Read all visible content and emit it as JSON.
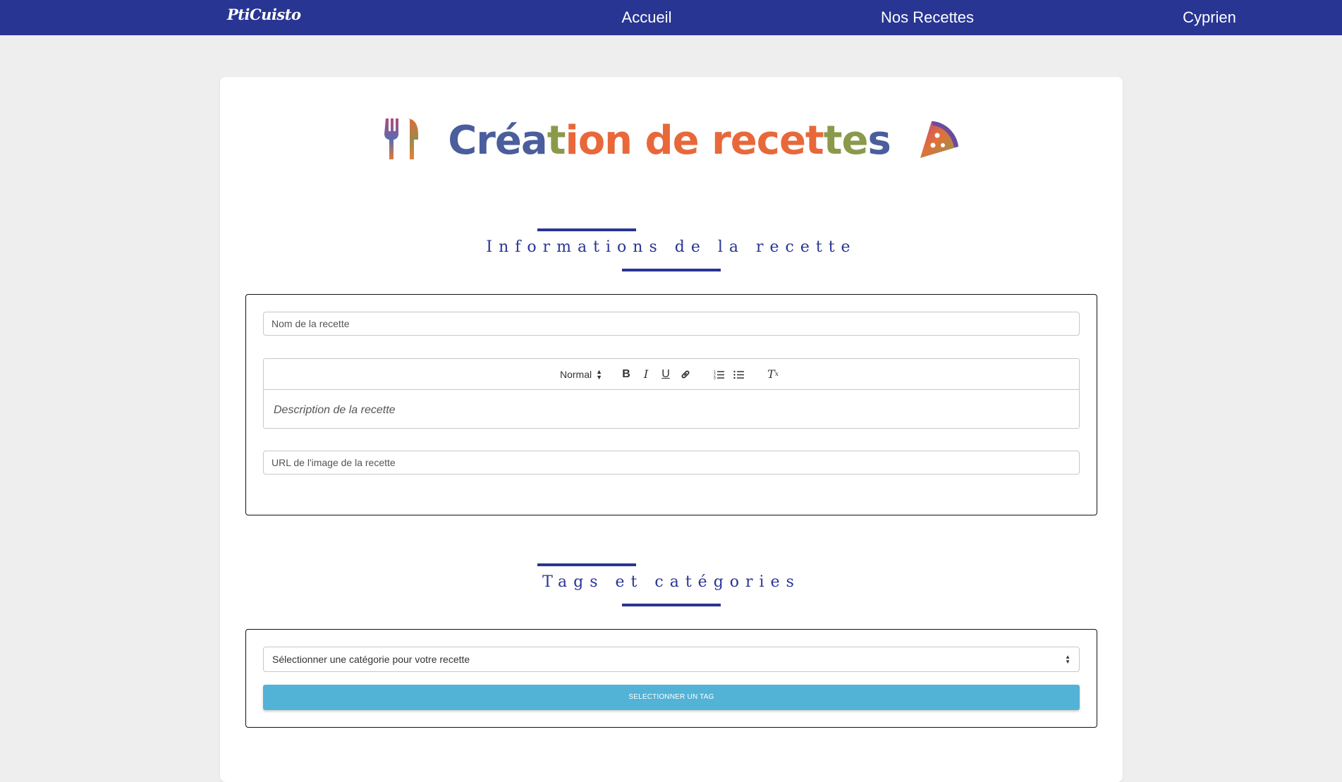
{
  "nav": {
    "logo": "PtiCuisto",
    "links": [
      "Accueil",
      "Nos Recettes",
      "Cyprien"
    ]
  },
  "page": {
    "title": "Création de recettes",
    "left_icon": "fork-knife-icon",
    "right_icon": "pizza-slice-icon"
  },
  "info_section": {
    "heading": "Informations de la recette",
    "name_placeholder": "Nom de la recette",
    "editor": {
      "format_select": "Normal",
      "tools": [
        "bold-icon",
        "italic-icon",
        "underline-icon",
        "link-icon",
        "ordered-list-icon",
        "bullet-list-icon",
        "clear-format-icon"
      ],
      "placeholder": "Description de la recette"
    },
    "image_placeholder": "URL de l'image de la recette"
  },
  "tags_section": {
    "heading": "Tags et catégories",
    "category_select": "Sélectionner une catégorie pour votre recette",
    "tag_button": "SELECTIONNER UN TAG"
  },
  "colors": {
    "navbar": "#283593",
    "accent": "#283593",
    "tag_button": "#52b3d6",
    "title_blue": "#4a5d9c",
    "title_orange": "#e8683a"
  }
}
